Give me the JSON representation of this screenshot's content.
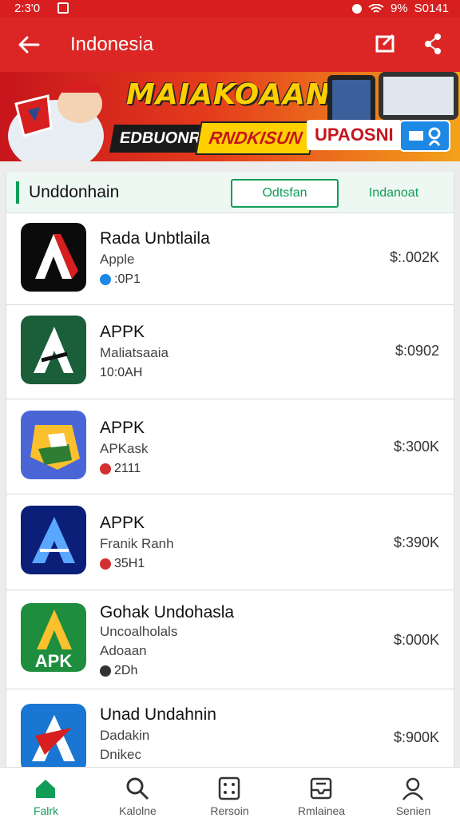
{
  "status": {
    "time": "2:3'0",
    "battery": "9%",
    "right_text": "S0141"
  },
  "appbar": {
    "title": "Indonesia"
  },
  "banner": {
    "headline": "MAIAKOAAN",
    "sub1": "EDBUONRN",
    "sub2": "RNDKISUN",
    "sub3": "UPAOSNI"
  },
  "list": {
    "header_title": "Unddonhain",
    "tab_active": "Odtsfan",
    "tab_other": "Indanoat",
    "items": [
      {
        "name": "Rada Unbtlaila",
        "publisher": "Apple",
        "extra": "",
        "meta": ":0P1",
        "price": "$:.002K",
        "badge_color": "#1e88e5"
      },
      {
        "name": "APPK",
        "publisher": "Maliatsaaia",
        "extra": "",
        "meta": "10:0AH",
        "price": "$:0902",
        "badge_color": ""
      },
      {
        "name": "APPK",
        "publisher": "APKask",
        "extra": "",
        "meta": "2111",
        "price": "$:300K",
        "badge_color": "#d32f2f"
      },
      {
        "name": "APPK",
        "publisher": "Franik Ranh",
        "extra": "",
        "meta": "35H1",
        "price": "$:390K",
        "badge_color": "#d32f2f"
      },
      {
        "name": "Gohak Undohasla",
        "publisher": "Uncoalholals",
        "extra": "Adoaan",
        "meta": "2Dh",
        "price": "$:000K",
        "badge_color": "#333333"
      },
      {
        "name": "Unad Undahnin",
        "publisher": "Dadakin",
        "extra": "Dnikec",
        "meta": "",
        "price": "$:900K",
        "badge_color": ""
      }
    ]
  },
  "nav": [
    {
      "label": "Falrk",
      "icon": "home-icon"
    },
    {
      "label": "Kalolne",
      "icon": "search-icon"
    },
    {
      "label": "Rersoin",
      "icon": "grid-icon"
    },
    {
      "label": "Rmlainea",
      "icon": "inbox-icon"
    },
    {
      "label": "Senien",
      "icon": "person-icon"
    }
  ],
  "colors": {
    "accent_red": "#dc2626",
    "accent_green": "#0f9d58"
  }
}
